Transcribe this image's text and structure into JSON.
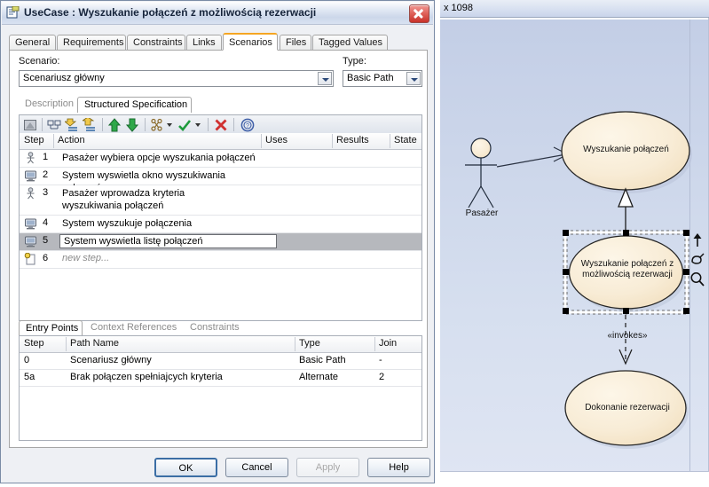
{
  "window": {
    "title": "UseCase : Wyszukanie połączeń z możliwością rezerwacji",
    "icon": "document-properties-icon",
    "close_label": "close-icon"
  },
  "tabs": [
    {
      "label": "General",
      "active": false
    },
    {
      "label": "Requirements",
      "active": false
    },
    {
      "label": "Constraints",
      "active": false
    },
    {
      "label": "Links",
      "active": false
    },
    {
      "label": "Scenarios",
      "active": true
    },
    {
      "label": "Files",
      "active": false
    },
    {
      "label": "Tagged Values",
      "active": false
    }
  ],
  "scenario": {
    "label": "Scenario:",
    "value": "Scenariusz główny",
    "type_label": "Type:",
    "type_value": "Basic Path"
  },
  "inner_tabs": [
    {
      "label": "Description",
      "active": false
    },
    {
      "label": "Structured Specification",
      "active": true
    }
  ],
  "toolbar": {
    "items": [
      {
        "name": "edit-step-icon",
        "title": "Edit"
      },
      {
        "name": "split-step-icon",
        "title": "Split"
      },
      {
        "name": "insert-step-above-icon",
        "title": "Insert above"
      },
      {
        "name": "insert-step-below-icon",
        "title": "Insert below"
      },
      {
        "name": "move-up-icon",
        "title": "Move up"
      },
      {
        "name": "move-down-icon",
        "title": "Move down"
      },
      {
        "name": "structure-icon",
        "title": "Structure"
      },
      {
        "name": "apply-check-icon",
        "title": "Apply"
      },
      {
        "name": "delete-icon",
        "title": "Delete"
      },
      {
        "name": "help-icon",
        "title": "Help"
      }
    ]
  },
  "steps_grid": {
    "columns": [
      "Step",
      "Action",
      "Uses",
      "Results",
      "State"
    ],
    "rows": [
      {
        "step": "1",
        "action": "Pasażer wybiera opcje wyszukania połączeń",
        "actor": "actor-icon",
        "uses": "",
        "results": "",
        "state": "",
        "selected": false
      },
      {
        "step": "2",
        "action": "System wyswietla okno wyszukiwania połączeń",
        "actor": "system-icon",
        "uses": "",
        "results": "",
        "state": "",
        "selected": false
      },
      {
        "step": "3",
        "action": "Pasażer wprowadza kryteria wyszukiwania połączeń",
        "actor": "actor-icon",
        "uses": "",
        "results": "",
        "state": "",
        "selected": false
      },
      {
        "step": "4",
        "action": "System wyszukuje połączenia",
        "actor": "system-icon",
        "uses": "",
        "results": "",
        "state": "",
        "selected": false
      },
      {
        "step": "5",
        "action": "System wyswietla listę połączeń",
        "actor": "system-icon",
        "uses": "",
        "results": "",
        "state": "",
        "selected": true
      },
      {
        "step": "6",
        "action": "new step...",
        "actor": "new-step-icon",
        "uses": "",
        "results": "",
        "state": "",
        "selected": false,
        "placeholder": true
      }
    ]
  },
  "entry_tabs": [
    {
      "label": "Entry Points",
      "active": true
    },
    {
      "label": "Context References",
      "active": false
    },
    {
      "label": "Constraints",
      "active": false
    }
  ],
  "entry_grid": {
    "columns": [
      "Step",
      "Path Name",
      "Type",
      "Join"
    ],
    "rows": [
      {
        "step": "0",
        "path_name": "Scenariusz główny",
        "type": "Basic Path",
        "join": "-"
      },
      {
        "step": "5a",
        "path_name": "Brak połączen spełniajcych kryteria",
        "type": "Alternate",
        "join": "2"
      }
    ]
  },
  "buttons": [
    {
      "label": "OK",
      "state": "default"
    },
    {
      "label": "Cancel",
      "state": "normal"
    },
    {
      "label": "Apply",
      "state": "disabled"
    },
    {
      "label": "Help",
      "state": "normal"
    }
  ],
  "diagram": {
    "topbar_text": "x 1098",
    "actor": {
      "label": "Pasażer",
      "icon": "stick-figure-actor-icon"
    },
    "use_cases": [
      {
        "label": "Wyszukanie połączeń",
        "selected": false
      },
      {
        "label": "Wyszukanie połączeń z możliwością rezerwacji",
        "selected": true
      },
      {
        "label": "Dokonanie rezerwacji",
        "selected": false
      }
    ],
    "connector_label": "«invokes»",
    "tools": [
      {
        "name": "pointer-up-arrow-icon"
      },
      {
        "name": "pan-hand-icon"
      },
      {
        "name": "zoom-magnifier-icon"
      }
    ],
    "colors": {
      "canvas": "#ced8ec",
      "use_case_fill": "#f7e7cb",
      "use_case_border": "#2b2b2b",
      "selection_handle": "#000000"
    }
  }
}
